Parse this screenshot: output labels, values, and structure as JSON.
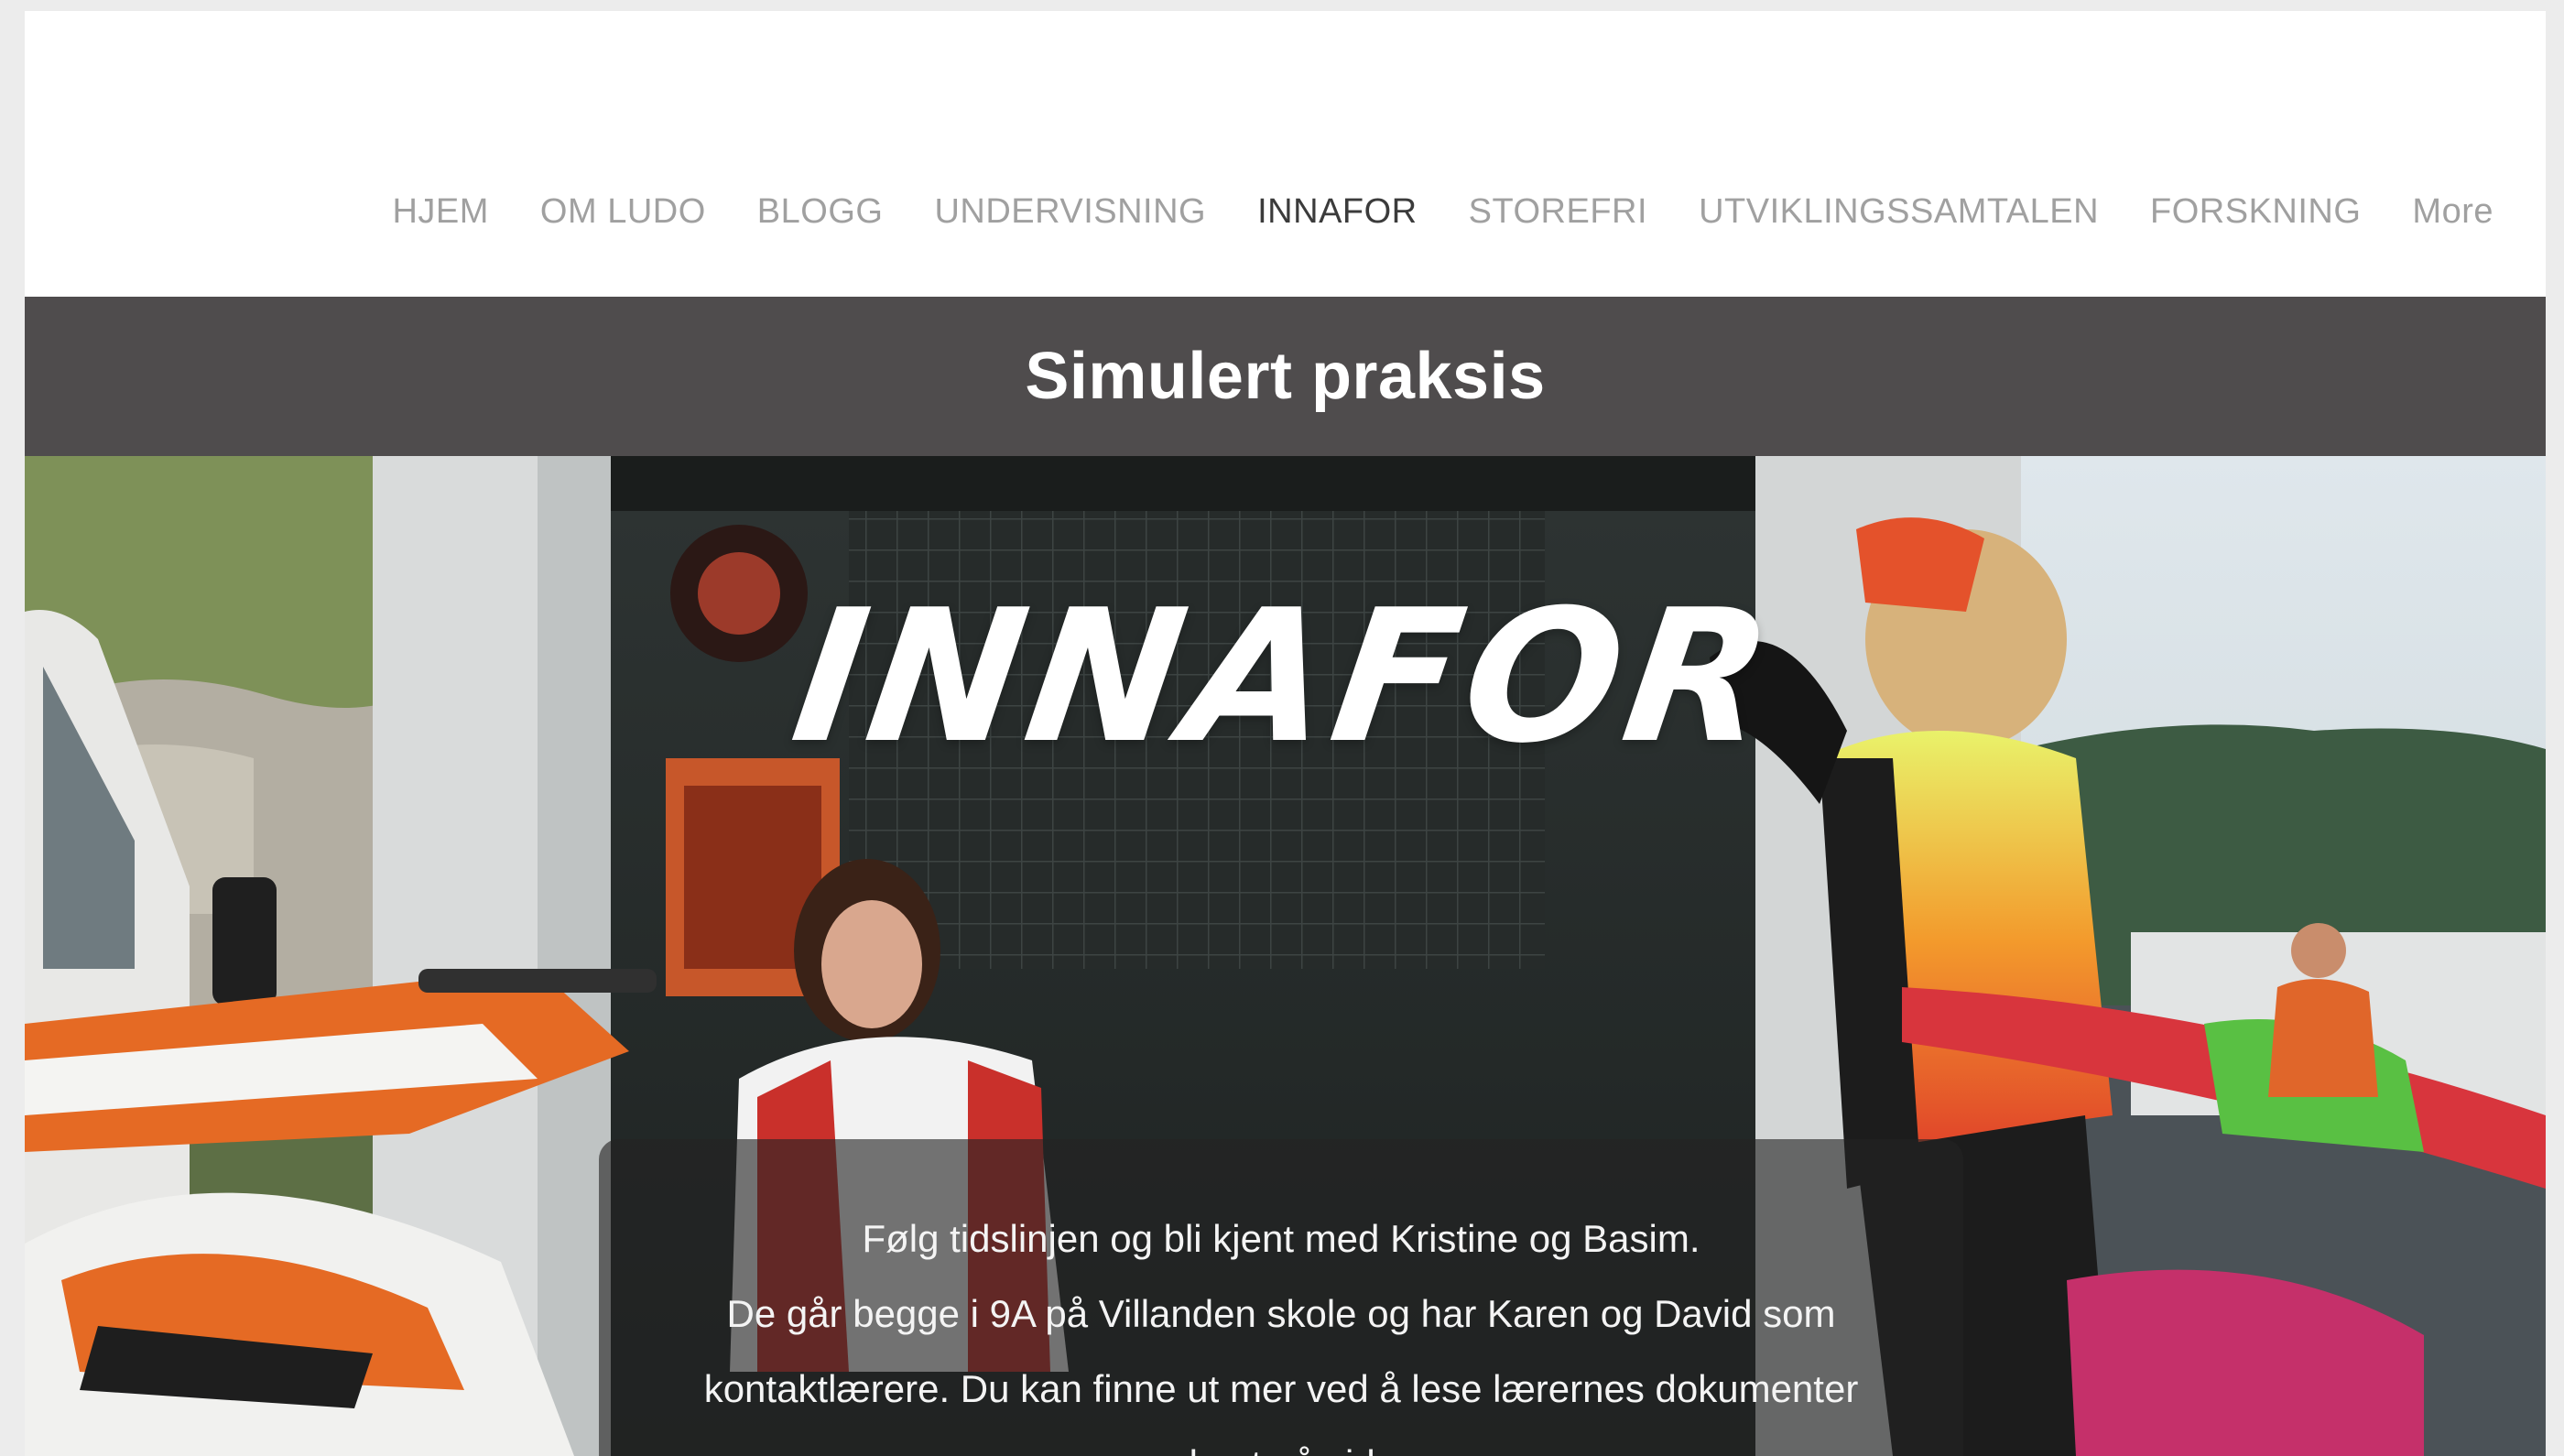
{
  "nav": {
    "items": [
      {
        "label": "HJEM"
      },
      {
        "label": "OM LUDO"
      },
      {
        "label": "BLOGG"
      },
      {
        "label": "UNDERVISNING"
      },
      {
        "label": "INNAFOR"
      },
      {
        "label": "STOREFRI"
      },
      {
        "label": "UTVIKLINGSSAMTALEN"
      },
      {
        "label": "FORSKNING"
      },
      {
        "label": "More"
      }
    ],
    "active": "INNAFOR"
  },
  "title_bar": {
    "title": "Simulert praksis"
  },
  "hero": {
    "logo_text": "INNAFOR",
    "info_lines": [
      "Følg tidslinjen og bli kjent med Kristine og Basim.",
      "De går begge i 9A på Villanden skole og har Karen og David som",
      "kontaktlærere. Du kan finne ut mer ved å lese lærernes dokumenter",
      "nederst på siden."
    ]
  },
  "colors": {
    "title_bar_bg": "#4f4c4d",
    "nav_text": "#a0a0a0",
    "nav_active": "#3b3b3b"
  }
}
